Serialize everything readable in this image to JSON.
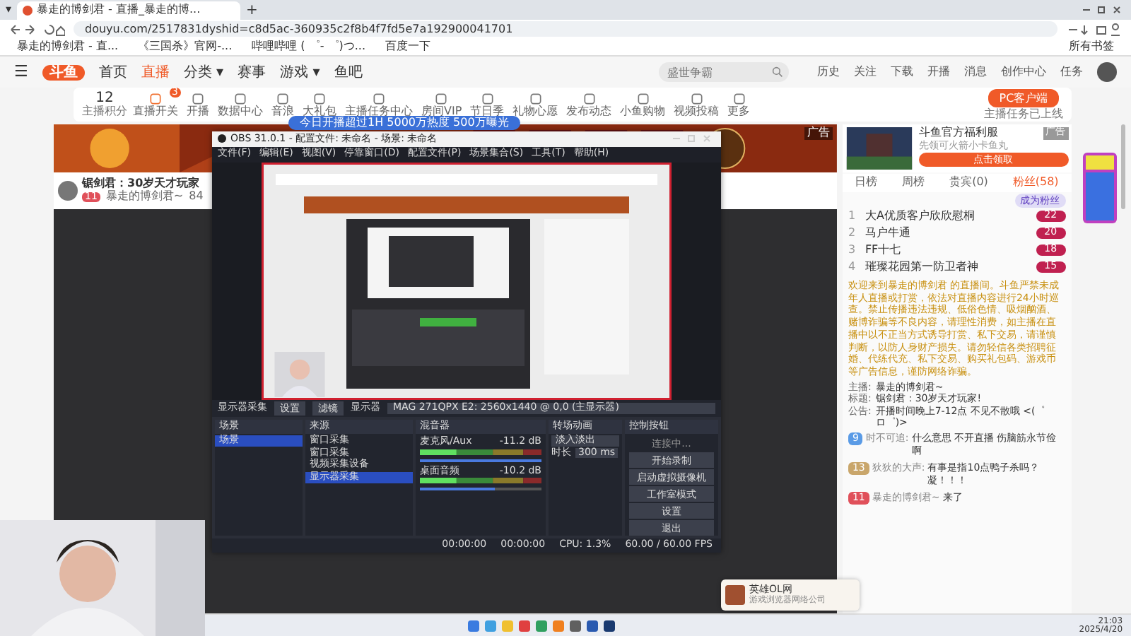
{
  "browser": {
    "tab_menu": "▾",
    "tab_title": "暴走的博剑君 - 直播_暴走的博...",
    "new_tab": "+",
    "url": "douyu.com/2517831dyshid=c8d5ac-360935c2f8b4f7fd5e7a192900041701",
    "bookmarks": [
      "暴走的博剑君 - 直...",
      "《三国杀》官网-...",
      "哔哩哔哩 ( ゜- ゜)つ...",
      "百度一下"
    ],
    "all_bookmarks": "所有书签"
  },
  "site": {
    "menu": "☰",
    "logo": "斗鱼",
    "nav": [
      {
        "label": "首页",
        "selected": false
      },
      {
        "label": "直播",
        "selected": true
      },
      {
        "label": "分类 ▾",
        "selected": false
      },
      {
        "label": "赛事",
        "selected": false
      },
      {
        "label": "游戏 ▾",
        "selected": false
      },
      {
        "label": "鱼吧",
        "selected": false
      }
    ],
    "search": {
      "placeholder": "盛世争霸"
    },
    "user_links": [
      "历史",
      "关注",
      "下载",
      "开播",
      "消息",
      "创作中心",
      "任务"
    ]
  },
  "toolbar": {
    "points": "12",
    "points_label": "主播积分",
    "badge": "3",
    "items": [
      "直播开关",
      "开播",
      "数据中心",
      "音浪",
      "大礼包",
      "主播任务中心",
      "房间VIP",
      "节日季",
      "礼物心愿",
      "发布动态",
      "小鱼购物",
      "视频投稿",
      "更多"
    ],
    "client_button": "PC客户端",
    "client_note": "主播任务已上线",
    "tooltip": "今日开播超过1H  5000万热度  500万曝光"
  },
  "banner": {
    "ad_label": "广告"
  },
  "streamer": {
    "title": "锯剑君：30岁天才玩家",
    "level": "11",
    "name": "暴走的博剑君~",
    "fans": "84"
  },
  "obs": {
    "title": "OBS 31.0.1 - 配置文件: 未命名 - 场景: 未命名",
    "menu": [
      "文件(F)",
      "编辑(E)",
      "视图(V)",
      "停靠窗口(D)",
      "配置文件(P)",
      "场景集合(S)",
      "工具(T)",
      "帮助(H)"
    ],
    "source_name": "显示器采集",
    "props": "设置",
    "filters": "滤镜",
    "display_label": "显示器",
    "display": "MAG 271QPX E2: 2560x1440 @ 0,0 (主显示器)",
    "docks": {
      "scenes": "场景",
      "sources": "来源",
      "mixer": "混音器",
      "transitions": "转场动画",
      "controls": "控制按钮"
    },
    "scenes": [
      {
        "name": "场景",
        "selected": true
      }
    ],
    "sources": [
      {
        "name": "窗口采集",
        "selected": false
      },
      {
        "name": "窗口采集",
        "selected": false
      },
      {
        "name": "视频采集设备",
        "selected": false
      },
      {
        "name": "显示器采集",
        "selected": true
      }
    ],
    "channels": [
      {
        "name": "麦克风/Aux",
        "reading": "-11.2 dB",
        "level": 1.0
      },
      {
        "name": "桌面音频",
        "reading": "-10.2 dB",
        "level": 0.62
      }
    ],
    "transition": "淡入淡出",
    "duration_label": "时长",
    "duration": "300 ms",
    "controls": [
      "连接中...",
      "开始录制",
      "启动虚拟摄像机",
      "工作室模式",
      "设置",
      "退出"
    ],
    "status": {
      "rec": "00:00:00",
      "stream": "00:00:00",
      "cpu": "CPU: 1.3%",
      "fps": "60.00 / 60.00 FPS"
    }
  },
  "side": {
    "ad": {
      "title": "斗鱼官方福利服",
      "subtitle": "先领可火箭小卡鱼丸",
      "button": "点击领取",
      "ad_label": "广告"
    },
    "tabs": [
      {
        "label": "日榜",
        "selected": false
      },
      {
        "label": "周榜",
        "selected": false
      },
      {
        "label": "贵宾(0)",
        "selected": false
      },
      {
        "label": "粉丝(58)",
        "selected": true
      }
    ],
    "fan_button": "成为粉丝",
    "ranks": [
      {
        "rank": "1",
        "name": "大A优质客户欣欣慰桐",
        "level": "22"
      },
      {
        "rank": "2",
        "name": "马户牛通",
        "level": "20"
      },
      {
        "rank": "3",
        "name": "FF十七",
        "level": "18"
      },
      {
        "rank": "4",
        "name": "璀璨花园第一防卫者神",
        "level": "15"
      }
    ],
    "notice": "欢迎来到暴走的博剑君 的直播间。斗鱼严禁未成年人直播或打赏，依法对直播内容进行24小时巡查。禁止传播违法违规、低俗色情、吸烟酗酒、赌博诈骗等不良内容，请理性消费，如主播在直播中以不正当方式诱导打赏、私下交易，请谨慎判断，以防人身财产损失。请勿轻信各类招聘征婚、代练代充、私下交易、购买礼包码、游戏币等广告信息，谨防网络诈骗。",
    "info": [
      {
        "label": "主播:",
        "text": "暴走的博剑君~"
      },
      {
        "label": "标题:",
        "text": "锯剑君：30岁天才玩家!"
      },
      {
        "label": "公告:",
        "text": "开播时间晚上7-12点 不见不散哦 <(゜ロ゜)>"
      }
    ],
    "chat": [
      {
        "badge": "9",
        "color": "#5a9be6",
        "user": "时不可追:",
        "text": "什么意思 不开直播 伤脑筋永节俭啊"
      },
      {
        "badge": "13",
        "color": "#c9a66b",
        "user": "狄狄的大声:",
        "text": "有事是指10点鸭子杀吗？凝！！！"
      },
      {
        "badge": "11",
        "color": "#e0505a",
        "user": "暴走的博剑君~",
        "text": "来了"
      }
    ]
  },
  "notification": {
    "title": "英雄OL网",
    "subtitle": "游戏浏览器网络公司"
  },
  "clock": {
    "time": "21:03",
    "date": "2025/4/20"
  }
}
